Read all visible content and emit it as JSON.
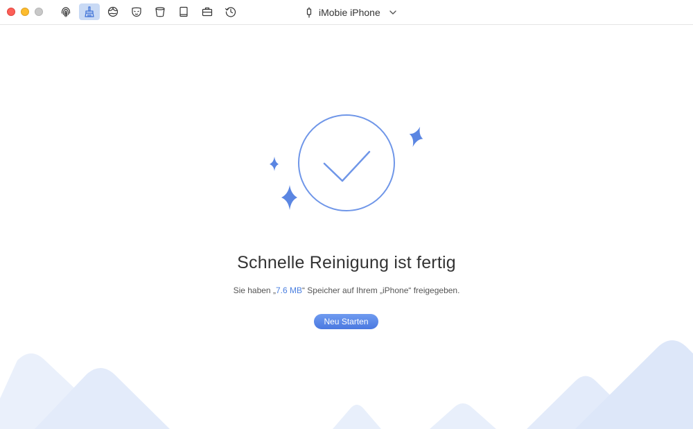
{
  "window": {
    "traffic_lights": [
      "close",
      "minimize",
      "zoom"
    ],
    "colors": {
      "close": "#fc5f57",
      "minimize": "#fdbc2e",
      "zoom": "#c8c8c8"
    }
  },
  "toolbar": {
    "icons": [
      {
        "name": "fingerprint-icon",
        "active": false
      },
      {
        "name": "broom-cleaner-icon",
        "active": true
      },
      {
        "name": "globe-icon",
        "active": false
      },
      {
        "name": "privacy-mask-icon",
        "active": false
      },
      {
        "name": "trash-bin-icon",
        "active": false
      },
      {
        "name": "book-icon",
        "active": false
      },
      {
        "name": "toolbox-icon",
        "active": false
      },
      {
        "name": "history-clock-icon",
        "active": false
      }
    ],
    "active_color": "#c9daf5",
    "device_name": "iMobie iPhone"
  },
  "result": {
    "title": "Schnelle Reinigung ist fertig",
    "message_prefix": "Sie haben „",
    "freed_size": "7.6 MB",
    "message_suffix": "“ Speicher auf Ihrem „iPhone“ freigegeben.",
    "restart_label": "Neu Starten",
    "accent_color": "#4a7fe0"
  }
}
